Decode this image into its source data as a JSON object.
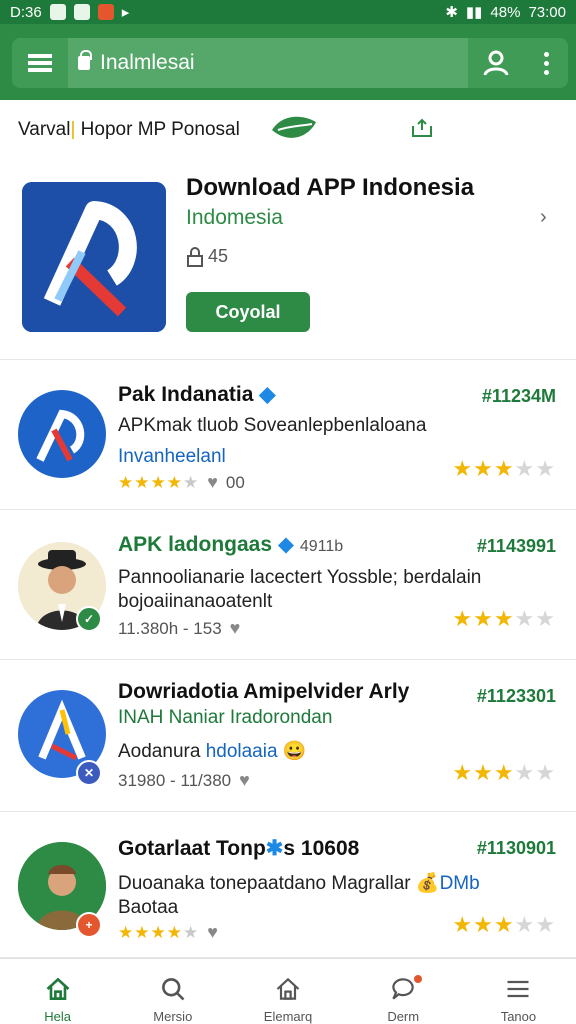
{
  "status": {
    "time_left": "D:36",
    "battery": "48%",
    "time_right": "73:00"
  },
  "address": {
    "text": "Inalmlesai"
  },
  "subheader": {
    "brand": "Varval",
    "sep": "|",
    "title": "Hopor MP Ponosal"
  },
  "featured": {
    "title": "Download APP Indonesia",
    "subtitle": "Indomesia",
    "downloads": "45",
    "button_label": "Coyolal"
  },
  "apps": [
    {
      "title": "Pak Indanatia",
      "size": "#11234M",
      "desc": "APKmak tluob Soveanlepbenlaloana",
      "link": "Invanheelanl",
      "meta_text": "00",
      "rating": 3,
      "card_rating": 4
    },
    {
      "title": "APK ladongaas",
      "tag": "4911b",
      "size": "#1143991",
      "desc": "Pannoolianarie lacectert Yossble; berdalain bojoaiinanaoatenlt",
      "meta_text": "11.380h - 153",
      "rating": 3
    },
    {
      "title": "Dowriadotia  Amipelvider Arly",
      "subtitle": "INAH Naniar Iradorondan",
      "size": "#1123301",
      "desc_plain": "Aodanura",
      "desc_link": "hdolaaia",
      "meta_text": "31980 - 11/380",
      "rating": 3
    },
    {
      "title": "Gotarlaat Tonp",
      "title_tail": "s 10608",
      "size": "#1130901",
      "desc": "Duoanaka tonepaatdano Magrallar",
      "desc_tail": "DMb",
      "desc2": "Baotaa",
      "rating": 3,
      "card_rating": 4
    }
  ],
  "nav": [
    {
      "label": "Hela",
      "icon": "home-icon"
    },
    {
      "label": "Mersio",
      "icon": "search-icon"
    },
    {
      "label": "Elemarq",
      "icon": "house-outline-icon"
    },
    {
      "label": "Derm",
      "icon": "chat-icon"
    },
    {
      "label": "Tanoo",
      "icon": "menu-icon"
    }
  ],
  "colors": {
    "primary": "#2e8b45",
    "accent_yellow": "#f2b705",
    "link_blue": "#1565c0"
  }
}
